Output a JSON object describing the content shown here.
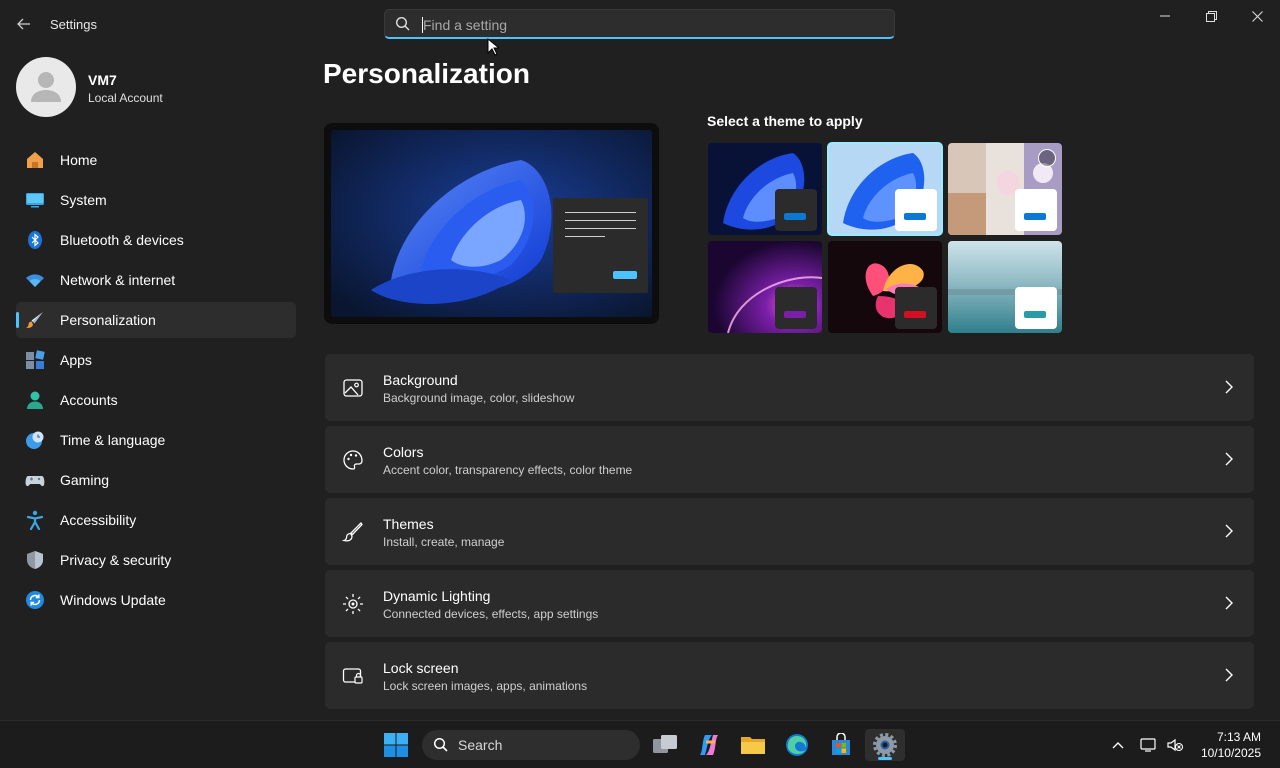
{
  "window": {
    "title": "Settings",
    "search_placeholder": "Find a setting"
  },
  "profile": {
    "name": "VM7",
    "account_type": "Local Account"
  },
  "sidebar": {
    "items": [
      {
        "label": "Home",
        "icon": "home-icon"
      },
      {
        "label": "System",
        "icon": "system-icon"
      },
      {
        "label": "Bluetooth & devices",
        "icon": "bluetooth-icon"
      },
      {
        "label": "Network & internet",
        "icon": "wifi-icon"
      },
      {
        "label": "Personalization",
        "icon": "paintbrush-icon",
        "active": true
      },
      {
        "label": "Apps",
        "icon": "apps-icon"
      },
      {
        "label": "Accounts",
        "icon": "accounts-icon"
      },
      {
        "label": "Time & language",
        "icon": "clock-globe-icon"
      },
      {
        "label": "Gaming",
        "icon": "gamepad-icon"
      },
      {
        "label": "Accessibility",
        "icon": "accessibility-icon"
      },
      {
        "label": "Privacy & security",
        "icon": "shield-icon"
      },
      {
        "label": "Windows Update",
        "icon": "update-icon"
      }
    ]
  },
  "main": {
    "page_title": "Personalization",
    "theme_heading": "Select a theme to apply",
    "cards": [
      {
        "title": "Background",
        "subtitle": "Background image, color, slideshow",
        "icon": "image-icon"
      },
      {
        "title": "Colors",
        "subtitle": "Accent color, transparency effects, color theme",
        "icon": "palette-icon"
      },
      {
        "title": "Themes",
        "subtitle": "Install, create, manage",
        "icon": "brush-icon"
      },
      {
        "title": "Dynamic Lighting",
        "subtitle": "Connected devices, effects, app settings",
        "icon": "lighting-icon"
      },
      {
        "title": "Lock screen",
        "subtitle": "Lock screen images, apps, animations",
        "icon": "lock-screen-icon"
      }
    ]
  },
  "taskbar": {
    "search_label": "Search",
    "time": "7:13 AM",
    "date": "10/10/2025"
  },
  "colors": {
    "accent": "#4cc2ff",
    "background": "#202020",
    "card": "#2b2b2b"
  }
}
